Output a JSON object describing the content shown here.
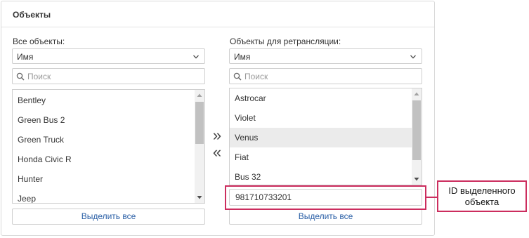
{
  "panel": {
    "title": "Объекты"
  },
  "left": {
    "label": "Все объекты:",
    "sort_value": "Имя",
    "search_placeholder": "Поиск",
    "items": [
      "Bentley",
      "Green Bus 2",
      "Green Truck",
      "Honda Civic R",
      "Hunter",
      "Jeep"
    ],
    "select_all": "Выделить все"
  },
  "right": {
    "label": "Объекты для ретрансляции:",
    "sort_value": "Имя",
    "search_placeholder": "Поиск",
    "items": [
      "Astrocar",
      "Violet",
      "Venus",
      "Fiat",
      "Bus 32"
    ],
    "selected_item": "Venus",
    "id_value": "981710733201",
    "select_all": "Выделить все"
  },
  "transfer": {
    "add_symbol": "»",
    "remove_symbol": "«"
  },
  "callout": {
    "line1": "ID выделенного",
    "line2": "объекта"
  },
  "colors": {
    "accent": "#cc2d5e",
    "link": "#2a5fa6",
    "selected_row": "#ebebeb"
  },
  "icons": {
    "chevron": "chevron-down-icon",
    "search": "search-icon",
    "scroll_up": "scroll-up-arrow-icon",
    "scroll_down": "scroll-down-arrow-icon"
  }
}
